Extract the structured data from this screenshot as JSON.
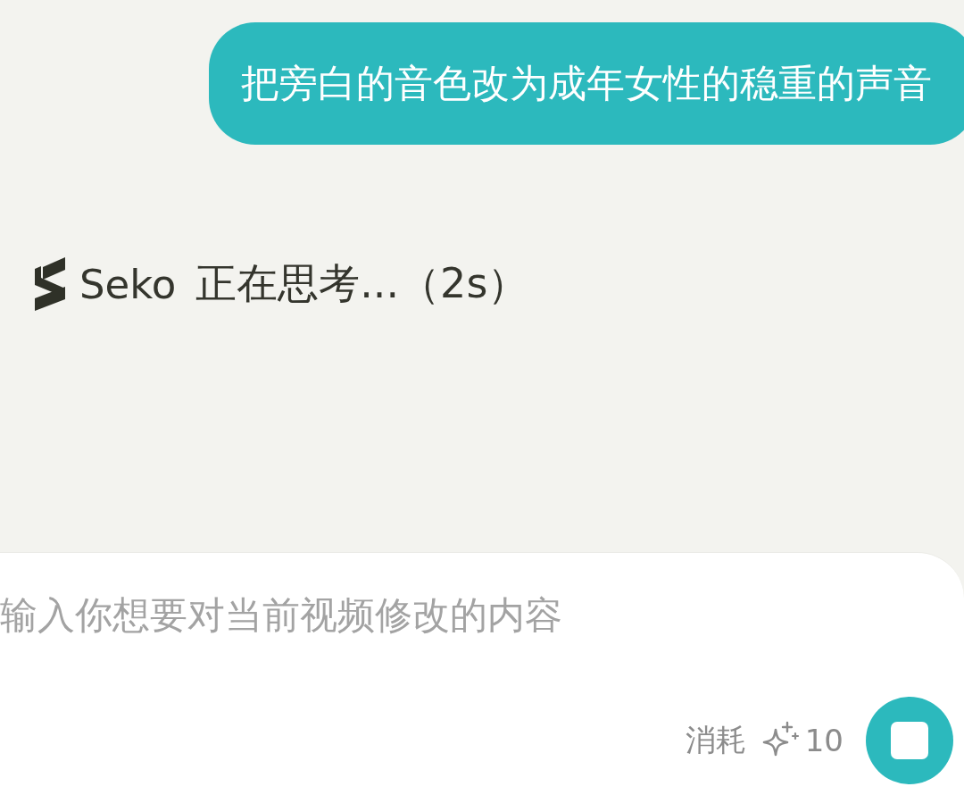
{
  "messages": [
    {
      "kind": "user",
      "text": "把旁白的音色改为成年女性的稳重的声音"
    },
    {
      "kind": "status",
      "sender": "Seko",
      "text": "正在思考...（2s）"
    }
  ],
  "composer": {
    "placeholder": "输入你想要对当前视频修改的内容",
    "cost_label": "消耗",
    "cost": "10",
    "generating": true
  }
}
